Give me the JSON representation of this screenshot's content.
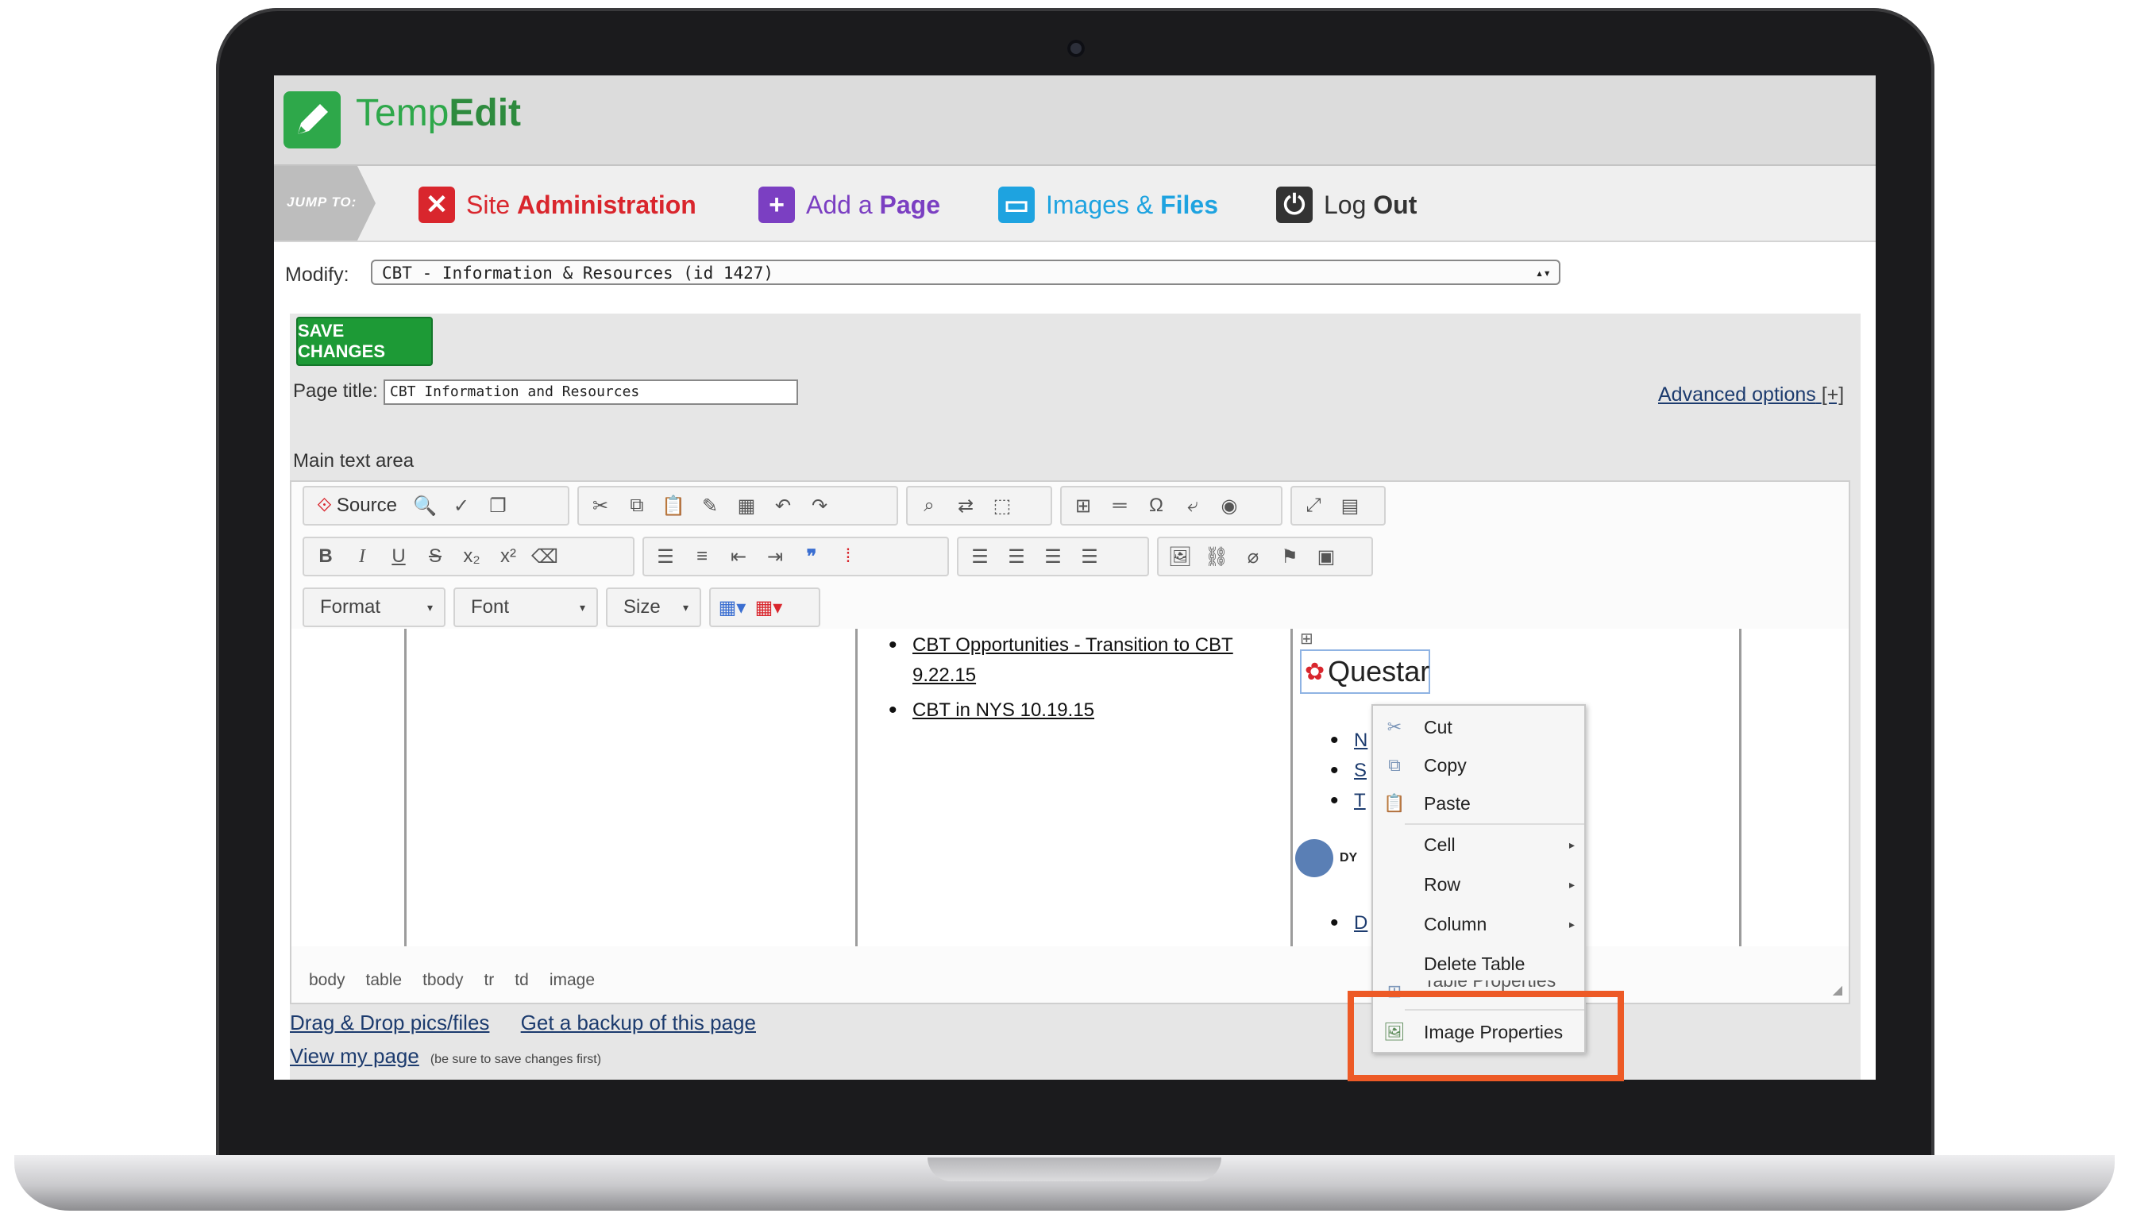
{
  "app": {
    "logo": {
      "text_light": "Temp",
      "text_bold": "Edit"
    }
  },
  "nav": {
    "jump_to": "JUMP TO:",
    "items": [
      {
        "light": "Site",
        "bold": "Administration",
        "icon": "x-icon",
        "color": "#d9262d"
      },
      {
        "light": "Add a",
        "bold": "Page",
        "icon": "plus-icon",
        "color": "#7b3fc2"
      },
      {
        "light": "Images &",
        "bold": "Files",
        "icon": "folder-icon",
        "color": "#1ea3e0"
      },
      {
        "light": "Log",
        "bold": "Out",
        "icon": "power-icon",
        "color": "#333333"
      }
    ]
  },
  "modify": {
    "label": "Modify:",
    "value": "CBT - Information & Resources (id 1427)"
  },
  "form": {
    "save_label": "SAVE CHANGES",
    "page_title_label": "Page title:",
    "page_title_value": "CBT Information and Resources",
    "advanced_label": "Advanced options",
    "advanced_suffix": "[+]",
    "main_text_label": "Main text area"
  },
  "editor": {
    "source_label": "Source",
    "format_label": "Format",
    "font_label": "Font",
    "size_label": "Size",
    "content": {
      "links": [
        "CBT Opportunities - Transition to CBT 9.22.15",
        "CBT in NYS 10.19.15"
      ],
      "image_text": "Questar",
      "clipped_links": [
        "N",
        "S",
        "T"
      ],
      "clipped_link_bottom": "D",
      "clipped_logo_text": "DY"
    },
    "path": [
      "body",
      "table",
      "tbody",
      "tr",
      "td",
      "image"
    ]
  },
  "context_menu": {
    "items": [
      "Cut",
      "Copy",
      "Paste",
      "Cell",
      "Row",
      "Column",
      "Delete Table",
      "Table Properties",
      "Image Properties"
    ]
  },
  "footer": {
    "drag_drop": "Drag & Drop pics/files",
    "backup": "Get a backup of this page",
    "view_page": "View my page",
    "view_hint": "(be sure to save changes first)"
  },
  "colors": {
    "accent_green": "#1d9a36",
    "highlight": "#ed5a26",
    "link": "#1c3b6e"
  }
}
